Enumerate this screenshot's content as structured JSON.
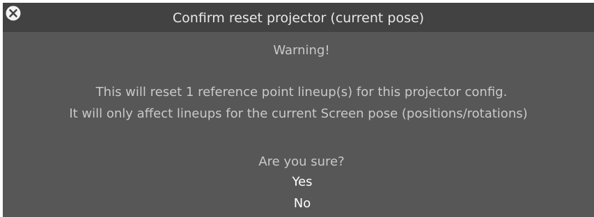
{
  "dialog": {
    "title": "Confirm reset projector (current pose)",
    "close_icon": "close-circle-icon",
    "warning": "Warning!",
    "message_line1": "This will reset 1 reference point lineup(s) for this projector config.",
    "message_line2": "It will only affect lineups for the current Screen pose (positions/rotations)",
    "question": "Are you sure?",
    "yes_label": "Yes",
    "no_label": "No"
  },
  "colors": {
    "titlebar": "#424242",
    "body": "#575757",
    "text": "#c9c9c9",
    "choice_text": "#ffffff"
  }
}
